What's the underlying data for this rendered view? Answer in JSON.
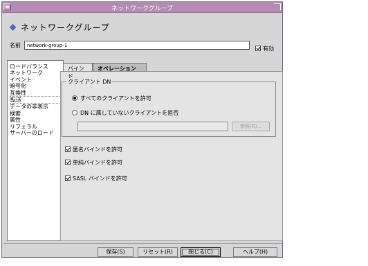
{
  "window": {
    "title": "ネットワークグループ"
  },
  "header": {
    "title": "ネットワークグループ"
  },
  "name": {
    "label": "名前",
    "value": "network-group-1"
  },
  "enabled": {
    "label": "有効"
  },
  "sidebar": {
    "items": [
      {
        "label": "ロードバランス"
      },
      {
        "label": "ネットワーク"
      },
      {
        "label": "イベント"
      },
      {
        "label": "暗号化"
      },
      {
        "label": "互換性"
      },
      {
        "label": "転送"
      },
      {
        "label": "データの非表示"
      },
      {
        "label": "検索"
      },
      {
        "label": "属性"
      },
      {
        "label": "リフェラル"
      },
      {
        "label": "サーバーのロード"
      }
    ]
  },
  "tabs": [
    {
      "label": "バインド"
    },
    {
      "label": "オペレーション"
    }
  ],
  "client_dn": {
    "group_label": "クライアント DN",
    "option_allow_all": "すべてのクライアントを許可",
    "option_reject": "DN に属していないクライアントを拒否",
    "browse_label": "参照(R)..."
  },
  "checks": {
    "anon_bind": "匿名バインドを許可",
    "simple_bind": "単純バインドを許可",
    "sasl_bind": "SASL バインドを許可"
  },
  "buttons": {
    "save": "保存(S)",
    "reset": "リセット(R)",
    "close": "閉じる(C)",
    "help": "ヘルプ(H)"
  }
}
